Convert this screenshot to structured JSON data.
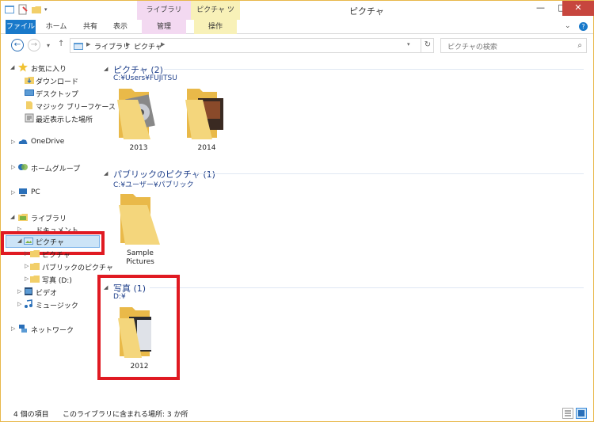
{
  "window": {
    "title": "ピクチャ",
    "context_tabs": [
      "ライブラリ ツール",
      "ピクチャ ツール"
    ],
    "controls": {
      "minimize": "—",
      "maximize": "□",
      "close": "✕"
    }
  },
  "ribbon": {
    "tabs": [
      "ファイル",
      "ホーム",
      "共有",
      "表示",
      "管理",
      "操作"
    ]
  },
  "addressbar": {
    "back": "←",
    "forward": "→",
    "recent": "▾",
    "up": "↑",
    "crumbs": [
      "ライブラリ",
      "ピクチャ"
    ],
    "refresh": "↻",
    "search_placeholder": "ピクチャの検索",
    "search_icon": "⌕"
  },
  "nav": {
    "favorites": "お気に入り",
    "downloads": "ダウンロード",
    "desktop": "デスクトップ",
    "briefcase": "マジック ブリーフケース",
    "recent": "最近表示した場所",
    "onedrive": "OneDrive",
    "homegroup": "ホームグループ",
    "pc": "PC",
    "libraries": "ライブラリ",
    "documents": "ドキュメント",
    "pictures": "ピクチャ",
    "pictures_sub": "ピクチャ",
    "public_pictures": "パブリックのピクチャ",
    "photos_d": "写真 (D:)",
    "video": "ビデオ",
    "music": "ミュージック",
    "network": "ネットワーク"
  },
  "groups": [
    {
      "title": "ピクチャ (2)",
      "path": "C:¥Users¥FUJITSU",
      "items": [
        {
          "label": "2013"
        },
        {
          "label": "2014"
        }
      ]
    },
    {
      "title": "パブリックのピクチャ (1)",
      "path": "C:¥ユーザー¥パブリック",
      "items": [
        {
          "label": "Sample Pictures"
        }
      ]
    },
    {
      "title": "写真 (1)",
      "path": "D:¥",
      "items": [
        {
          "label": "2012"
        }
      ]
    }
  ],
  "status": {
    "count": "4 個の項目",
    "locations": "このライブラリに含まれる場所: 3 か所"
  },
  "colors": {
    "accent": "#1979ca",
    "highlight_red": "#e01a22",
    "group_title": "#1e3f8a",
    "folder": "#f2cf69"
  }
}
